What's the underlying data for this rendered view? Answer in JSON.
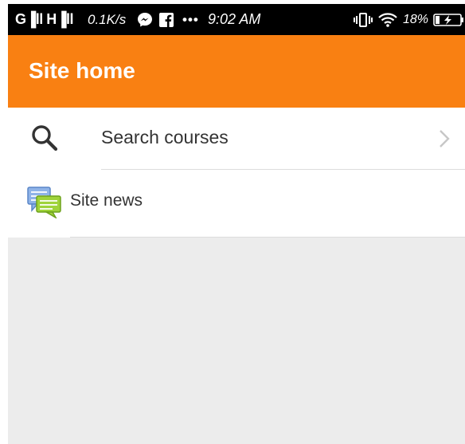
{
  "status_bar": {
    "signal": "G▐ll H▐ll",
    "network_speed": "0.1K/s",
    "more": "•••",
    "time": "9:02 AM",
    "battery_percent": "18%",
    "icons": [
      "messenger-icon",
      "facebook-icon",
      "vibrate-icon",
      "wifi-icon",
      "battery-charging-icon"
    ]
  },
  "app_bar": {
    "title": "Site home",
    "color": "#f98012"
  },
  "list": {
    "items": [
      {
        "label": "Search courses",
        "icon": "search-icon",
        "trailing_icon": "chevron-right-icon"
      },
      {
        "label": "Site news",
        "icon": "forum-news-icon"
      }
    ]
  },
  "colors": {
    "accent": "#f98012",
    "background": "#ececec",
    "status_bar": "#000000",
    "text": "#333333"
  }
}
